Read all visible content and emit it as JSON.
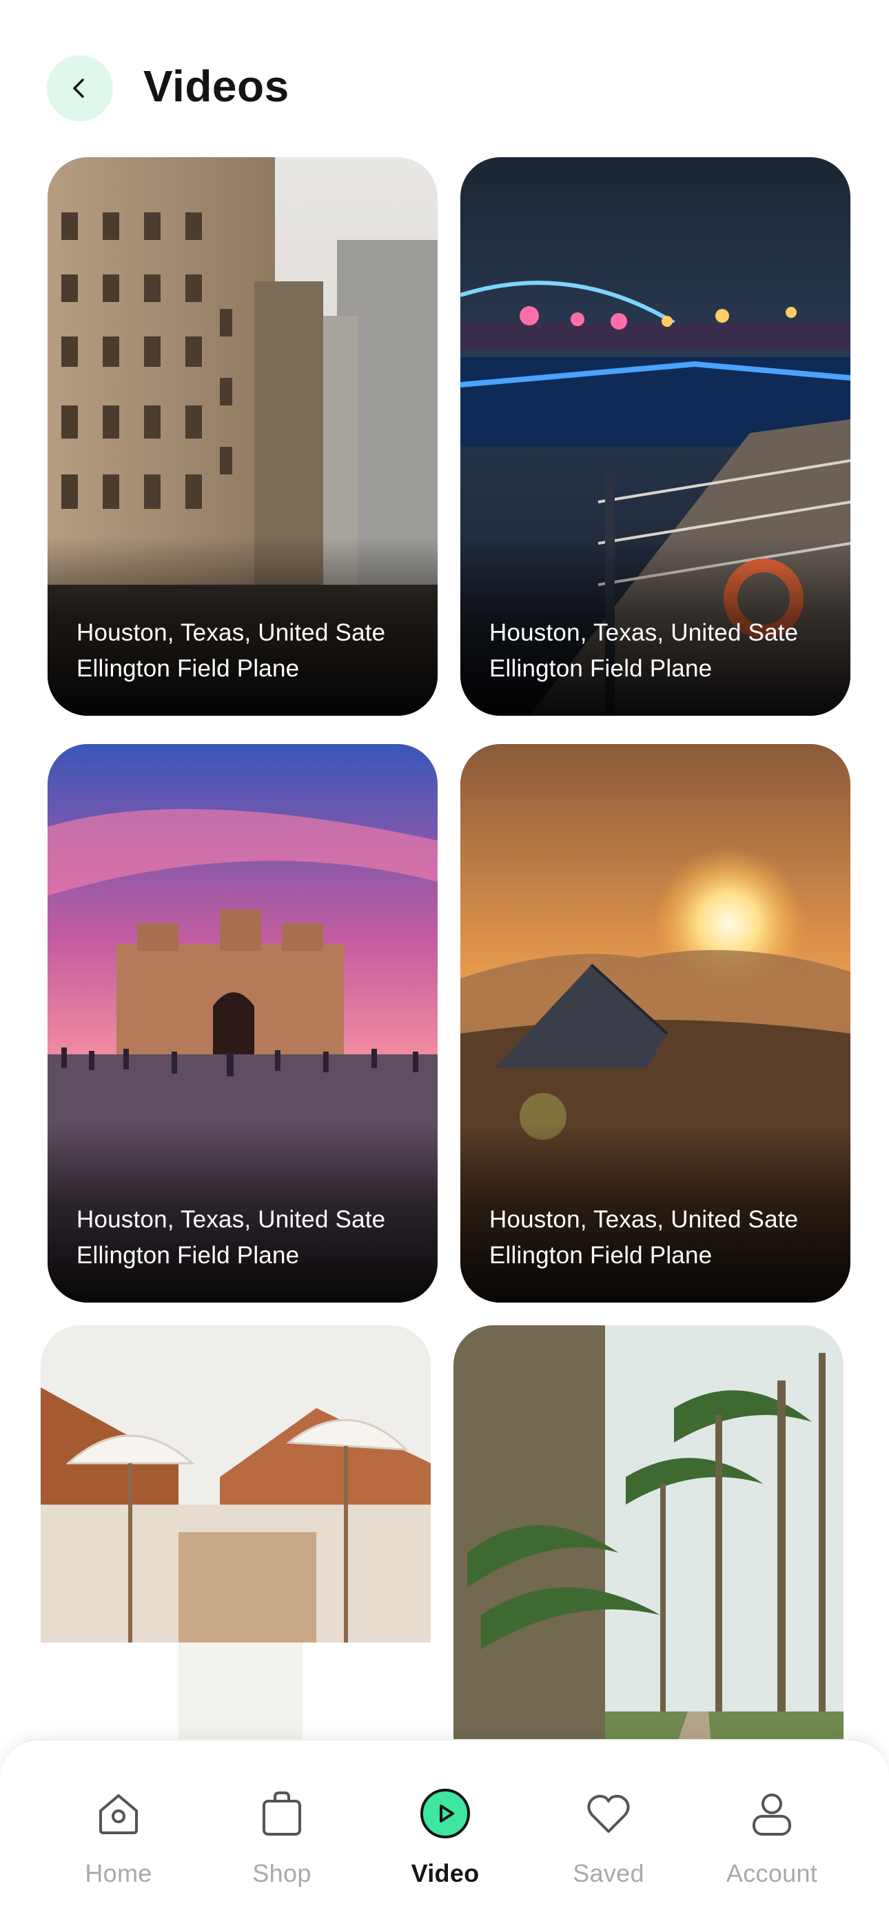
{
  "header": {
    "title": "Videos",
    "back_icon": "chevron-left-icon"
  },
  "colors": {
    "accent": "#3ee6a0",
    "accent_soft": "#dff8ec",
    "inactive": "#a9a9a9",
    "text": "#141414"
  },
  "cards": [
    {
      "line1": "Houston, Texas, United Sate",
      "line2": "Ellington Field Plane"
    },
    {
      "line1": "Houston, Texas, United Sate",
      "line2": "Ellington Field Plane"
    },
    {
      "line1": "Houston, Texas, United Sate",
      "line2": "Ellington Field Plane"
    },
    {
      "line1": "Houston, Texas, United Sate",
      "line2": "Ellington Field Plane"
    }
  ],
  "nav": [
    {
      "label": "Home",
      "icon": "home-icon",
      "active": false
    },
    {
      "label": "Shop",
      "icon": "shopping-bag-icon",
      "active": false
    },
    {
      "label": "Video",
      "icon": "play-icon",
      "active": true
    },
    {
      "label": "Saved",
      "icon": "heart-icon",
      "active": false
    },
    {
      "label": "Account",
      "icon": "user-icon",
      "active": false
    }
  ]
}
